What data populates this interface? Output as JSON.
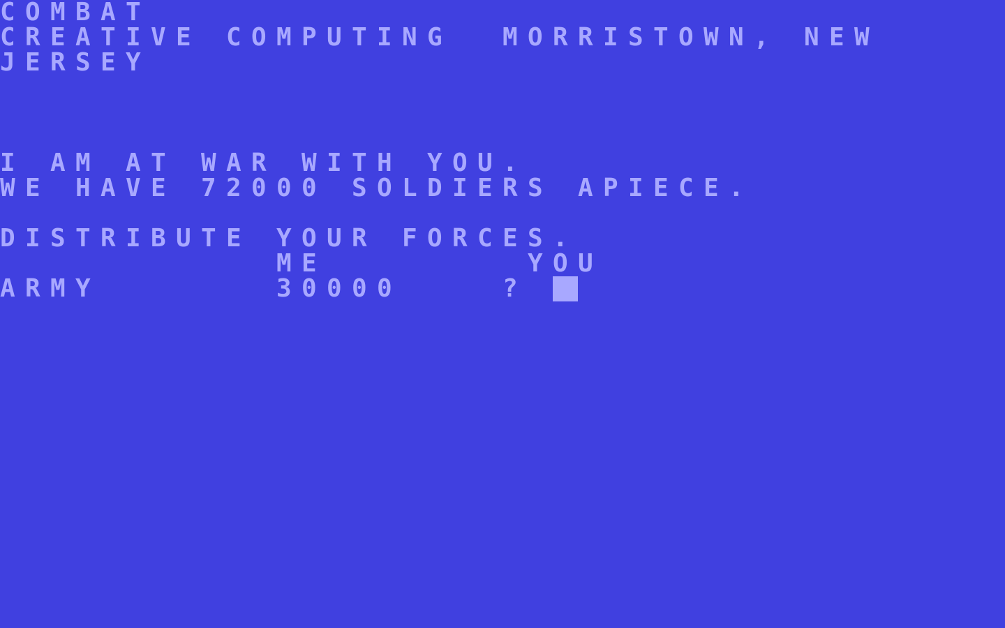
{
  "colors": {
    "background": "#4040e0",
    "foreground": "#a8a8ff"
  },
  "terminal": {
    "title": "COMBAT",
    "credit_line1": "CREATIVE COMPUTING",
    "credit_city": "MORRISTOWN, NEW",
    "credit_line2": "JERSEY",
    "war_line": "I AM AT WAR WITH YOU.",
    "soldiers_line": "WE HAVE 72000 SOLDIERS APIECE.",
    "distribute_line": "DISTRIBUTE YOUR FORCES.",
    "header_me": "ME",
    "header_you": "YOU",
    "row_label": "ARMY",
    "row_me_value": "30000",
    "prompt": "?",
    "input_value": ""
  }
}
